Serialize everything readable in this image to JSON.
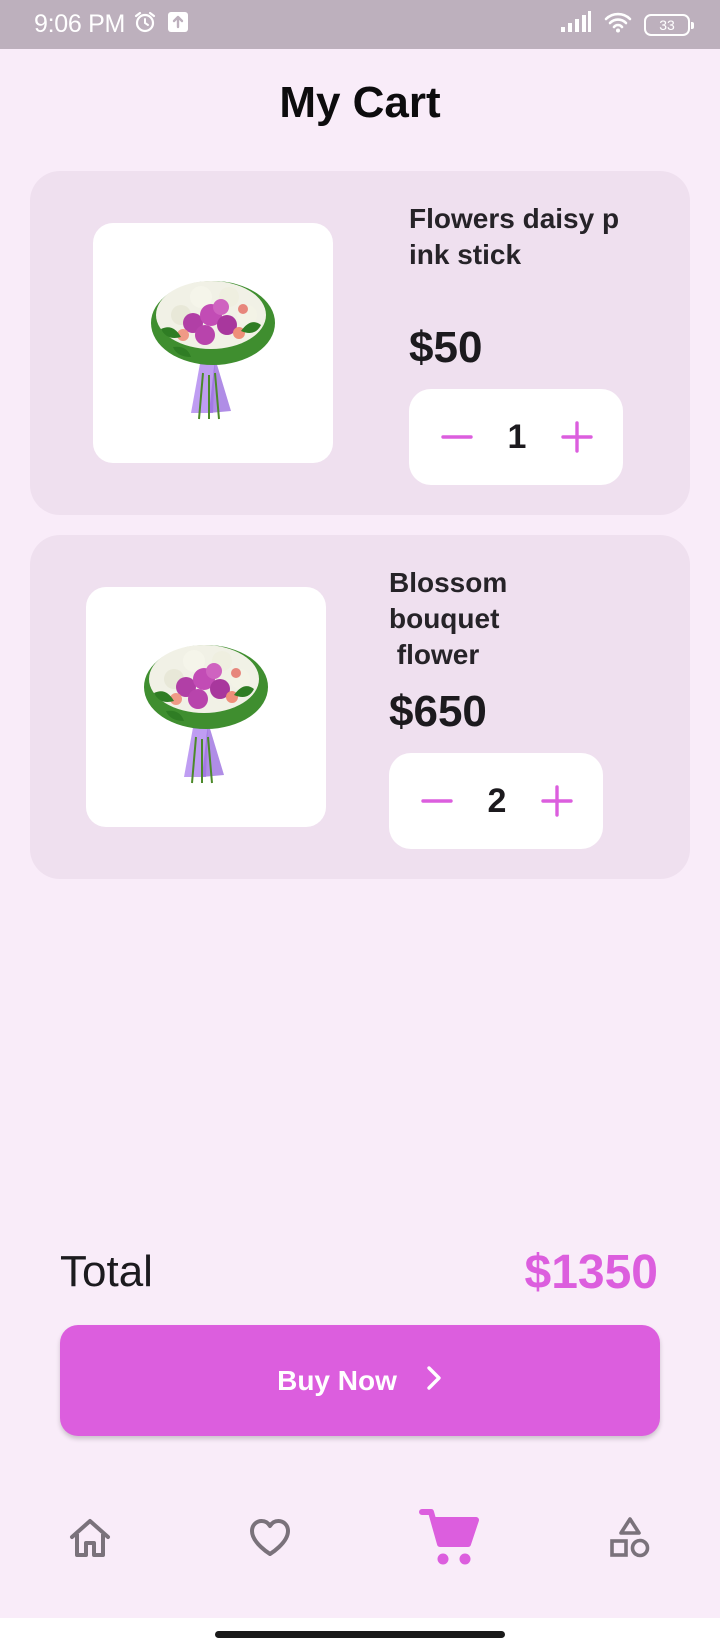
{
  "status_bar": {
    "time": "9:06 PM",
    "battery": "33",
    "icons": [
      "alarm-icon",
      "upload-icon",
      "signal-icon",
      "wifi-icon",
      "battery-icon"
    ]
  },
  "header": {
    "title": "My Cart"
  },
  "cart": {
    "items": [
      {
        "name": "Flowers daisy p\nink stick",
        "price": "$50",
        "quantity": "1",
        "image": "flower-bouquet-image"
      },
      {
        "name": "Blossom bouquet\n flower",
        "price": "$650",
        "quantity": "2",
        "image": "flower-bouquet-image"
      }
    ]
  },
  "summary": {
    "total_label": "Total",
    "total_value": "$1350"
  },
  "buy_button": {
    "label": "Buy Now",
    "icon": "chevron-right-icon"
  },
  "bottom_nav": {
    "items": [
      {
        "id": "home",
        "icon": "home-icon",
        "active": false
      },
      {
        "id": "favorites",
        "icon": "heart-icon",
        "active": false
      },
      {
        "id": "cart",
        "icon": "cart-icon",
        "active": true
      },
      {
        "id": "categories",
        "icon": "shapes-icon",
        "active": false
      }
    ]
  },
  "colors": {
    "accent": "#dc5ede",
    "background": "#f9ecf9",
    "card": "#efe0ef",
    "status_bar": "#bdb0bd",
    "nav_inactive": "#7a727b"
  }
}
